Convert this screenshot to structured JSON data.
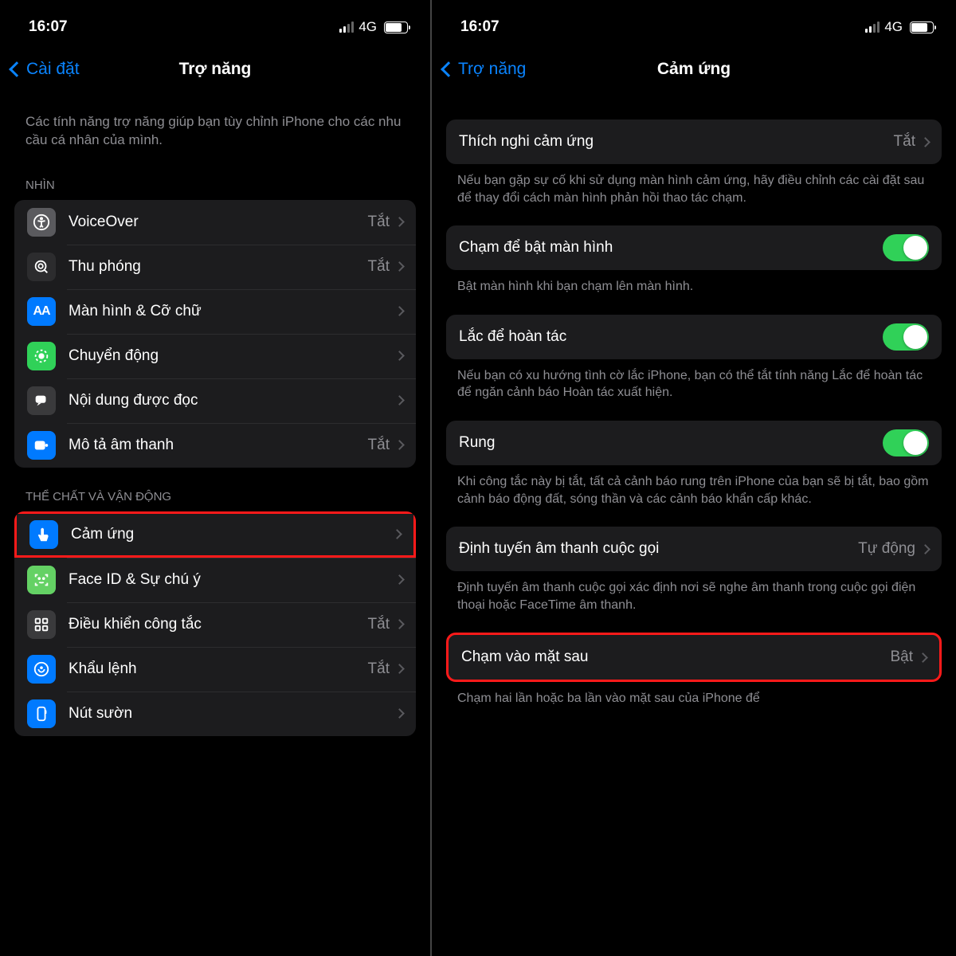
{
  "status": {
    "time": "16:07",
    "network": "4G"
  },
  "left": {
    "back": "Cài đặt",
    "title": "Trợ năng",
    "intro": "Các tính năng trợ năng giúp bạn tùy chỉnh iPhone cho các nhu cầu cá nhân của mình.",
    "section1_header": "NHÌN",
    "section1": [
      {
        "name": "voiceover",
        "label": "VoiceOver",
        "value": "Tắt",
        "icon_bg": "bg-gray",
        "icon": "accessibility"
      },
      {
        "name": "thuphong",
        "label": "Thu phóng",
        "value": "Tắt",
        "icon_bg": "bg-dark",
        "icon": "zoom"
      },
      {
        "name": "manhinh-cochu",
        "label": "Màn hình & Cỡ chữ",
        "value": "",
        "icon_bg": "bg-blue",
        "icon": "aa"
      },
      {
        "name": "chuyendong",
        "label": "Chuyển động",
        "value": "",
        "icon_bg": "bg-green",
        "icon": "motion"
      },
      {
        "name": "noidungdoc",
        "label": "Nội dung được đọc",
        "value": "",
        "icon_bg": "bg-darkgray",
        "icon": "speech"
      },
      {
        "name": "mota-amthanh",
        "label": "Mô tả âm thanh",
        "value": "Tắt",
        "icon_bg": "bg-blue",
        "icon": "audio-desc"
      }
    ],
    "section2_header": "THỂ CHẤT VÀ VẬN ĐỘNG",
    "section2": [
      {
        "name": "camung",
        "label": "Cảm ứng",
        "value": "",
        "icon_bg": "bg-blue",
        "icon": "touch",
        "highlight": true
      },
      {
        "name": "faceid-suchuy",
        "label": "Face ID & Sự chú ý",
        "value": "",
        "icon_bg": "bg-lime",
        "icon": "faceid"
      },
      {
        "name": "dieukhiencongtac",
        "label": "Điều khiển công tắc",
        "value": "Tắt",
        "icon_bg": "bg-darkgray",
        "icon": "switch"
      },
      {
        "name": "khaulenh",
        "label": "Khẩu lệnh",
        "value": "Tắt",
        "icon_bg": "bg-blue",
        "icon": "voice"
      },
      {
        "name": "nutsuon",
        "label": "Nút sườn",
        "value": "",
        "icon_bg": "bg-blue",
        "icon": "sidebtn"
      }
    ]
  },
  "right": {
    "back": "Trợ năng",
    "title": "Cảm ứng",
    "rows": {
      "thichnghi": {
        "label": "Thích nghi cảm ứng",
        "value": "Tắt"
      },
      "thichnghi_footer": "Nếu bạn gặp sự cố khi sử dụng màn hình cảm ứng, hãy điều chỉnh các cài đặt sau để thay đổi cách màn hình phản hồi thao tác chạm.",
      "tap_wake": {
        "label": "Chạm để bật màn hình",
        "on": true
      },
      "tap_wake_footer": "Bật màn hình khi bạn chạm lên màn hình.",
      "shake_undo": {
        "label": "Lắc để hoàn tác",
        "on": true
      },
      "shake_footer": "Nếu bạn có xu hướng tình cờ lắc iPhone, bạn có thể tắt tính năng Lắc để hoàn tác để ngăn cảnh báo Hoàn tác xuất hiện.",
      "vibration": {
        "label": "Rung",
        "on": true
      },
      "vibration_footer": "Khi công tắc này bị tắt, tất cả cảnh báo rung trên iPhone của bạn sẽ bị tắt, bao gồm cảnh báo động đất, sóng thần và các cảnh báo khẩn cấp khác.",
      "call_route": {
        "label": "Định tuyến âm thanh cuộc gọi",
        "value": "Tự động"
      },
      "call_route_footer": "Định tuyến âm thanh cuộc gọi xác định nơi sẽ nghe âm thanh trong cuộc gọi điện thoại hoặc FaceTime âm thanh.",
      "back_tap": {
        "label": "Chạm vào mặt sau",
        "value": "Bật",
        "highlight": true
      },
      "back_tap_footer": "Chạm hai lần hoặc ba lần vào mặt sau của iPhone để"
    }
  }
}
